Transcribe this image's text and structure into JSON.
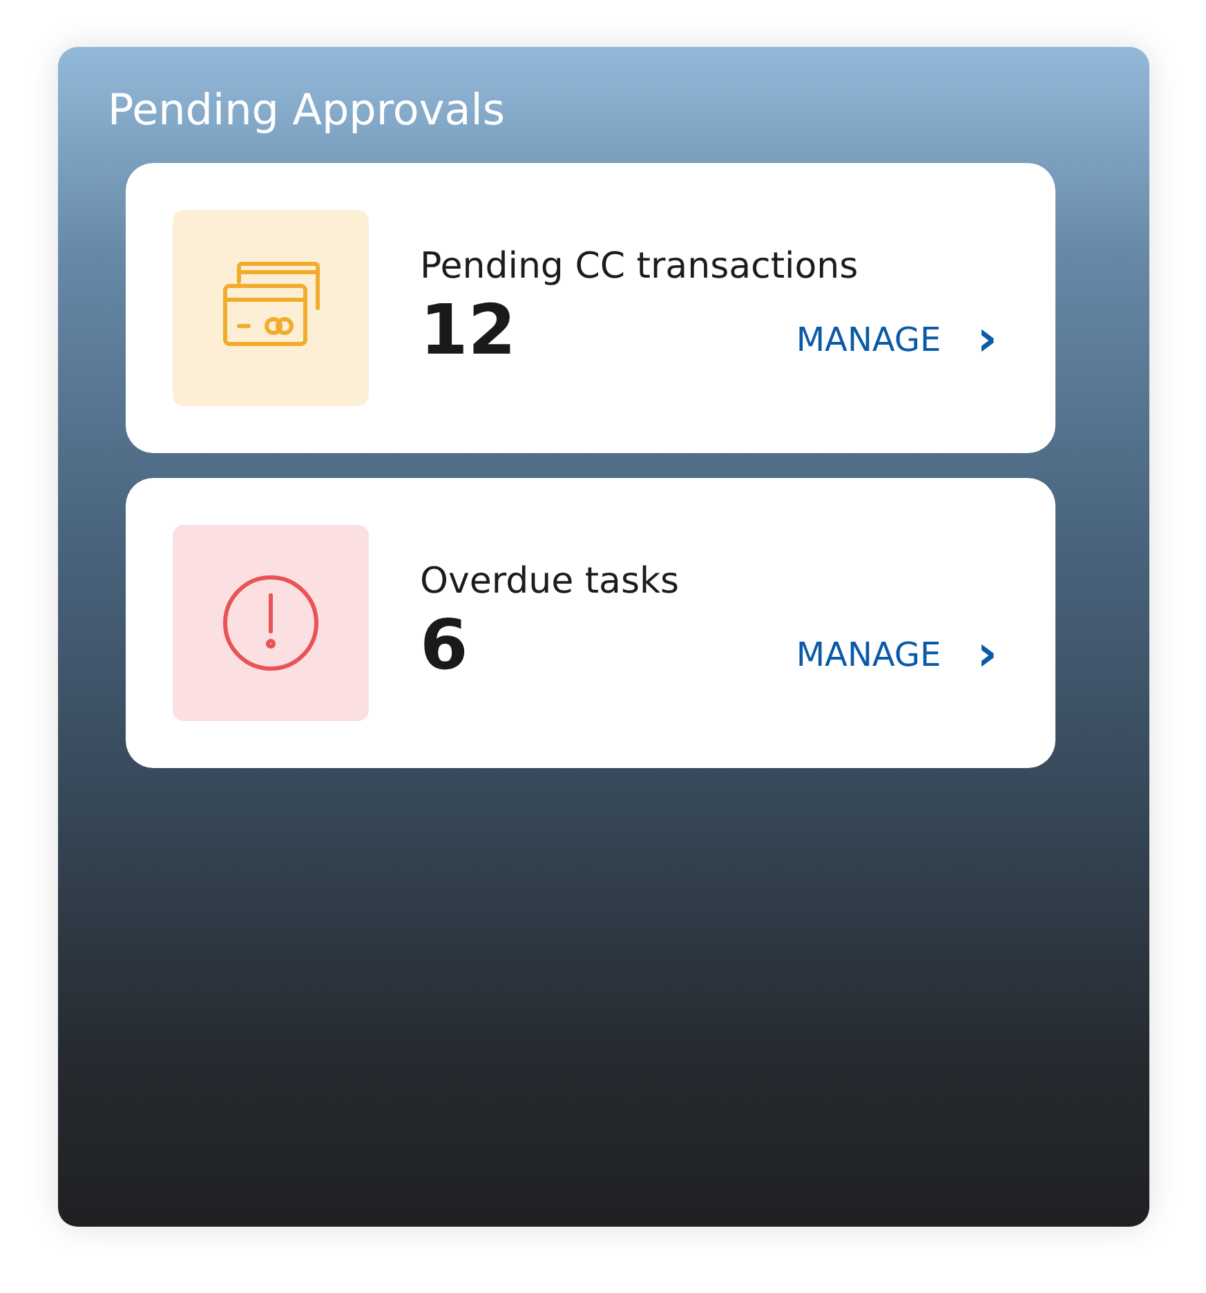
{
  "panel": {
    "title": "Pending Approvals"
  },
  "items": [
    {
      "kind": "cards",
      "label": "Pending CC transactions",
      "count": "12",
      "action": "MANAGE",
      "arrow": "›"
    },
    {
      "kind": "alert",
      "label": "Overdue tasks",
      "count": "6",
      "action": "MANAGE",
      "arrow": "›"
    }
  ]
}
